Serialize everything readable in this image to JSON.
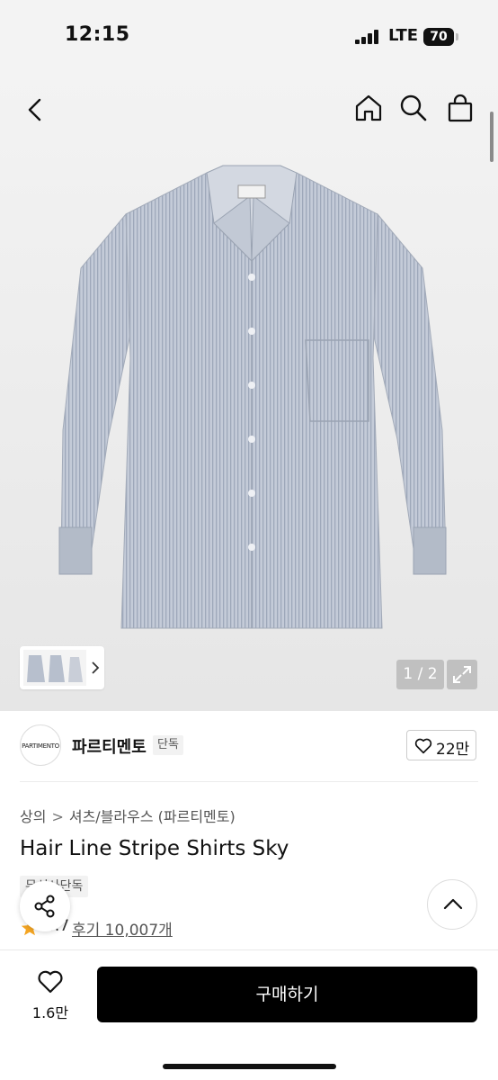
{
  "status_bar": {
    "time": "12:15",
    "network": "LTE",
    "battery": "70"
  },
  "gallery": {
    "page_indicator": "1 / 2",
    "current_image": 1,
    "total_images": 2
  },
  "icons": {
    "back": "back-icon",
    "home": "home-icon",
    "search": "search-icon",
    "bag": "shopping-bag-icon",
    "expand": "expand-icon",
    "heart": "heart-icon",
    "share": "share-icon",
    "scroll_top": "chevron-up-icon",
    "star": "star-icon"
  },
  "brand": {
    "logo_text": "PARTIMENTO",
    "name": "파르티멘토",
    "badge": "단독"
  },
  "like": {
    "count": "22만"
  },
  "breadcrumb": {
    "category": "상의",
    "separator": ">",
    "subcategory": "셔츠/블라우스 (파르티멘토)"
  },
  "product": {
    "title": "Hair Line Stripe Shirts Sky",
    "tag": "무신사단독",
    "rating": "4.7",
    "reviews": "후기 10,007개"
  },
  "bottom": {
    "wish_count": "1.6만",
    "buy_label": "구매하기"
  },
  "colors": {
    "accent": "#000000",
    "star": "#f5a623",
    "shirt": "#b7bfcd"
  }
}
